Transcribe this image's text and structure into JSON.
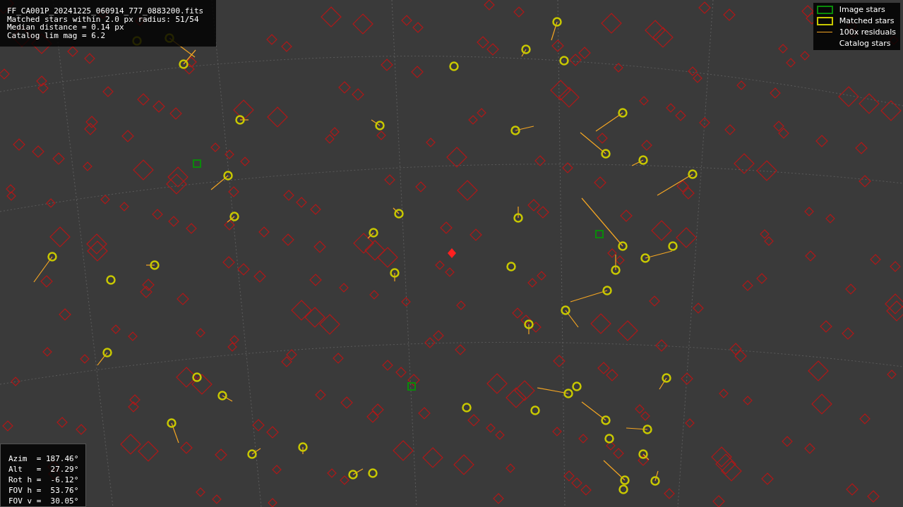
{
  "info_box": {
    "lines": [
      "FF_CA001P_20241225_060914_777_0883200.fits",
      "Matched stars within 2.0 px radius: 51/54",
      "Median distance = 0.14 px",
      "Catalog lim mag = 6.2"
    ]
  },
  "legend": {
    "items": [
      {
        "kind": "image",
        "label": "Image stars"
      },
      {
        "kind": "matched",
        "label": "Matched stars"
      },
      {
        "kind": "residual",
        "label": "100x residuals"
      },
      {
        "kind": "catalog",
        "label": "Catalog stars"
      }
    ]
  },
  "pointing_box": {
    "lines": [
      "Azim  = 187.46°",
      "Alt   =  27.29°",
      "Rot h =  -6.12°",
      "FOV h =  53.76°",
      "FOV v =  30.05°"
    ]
  }
}
